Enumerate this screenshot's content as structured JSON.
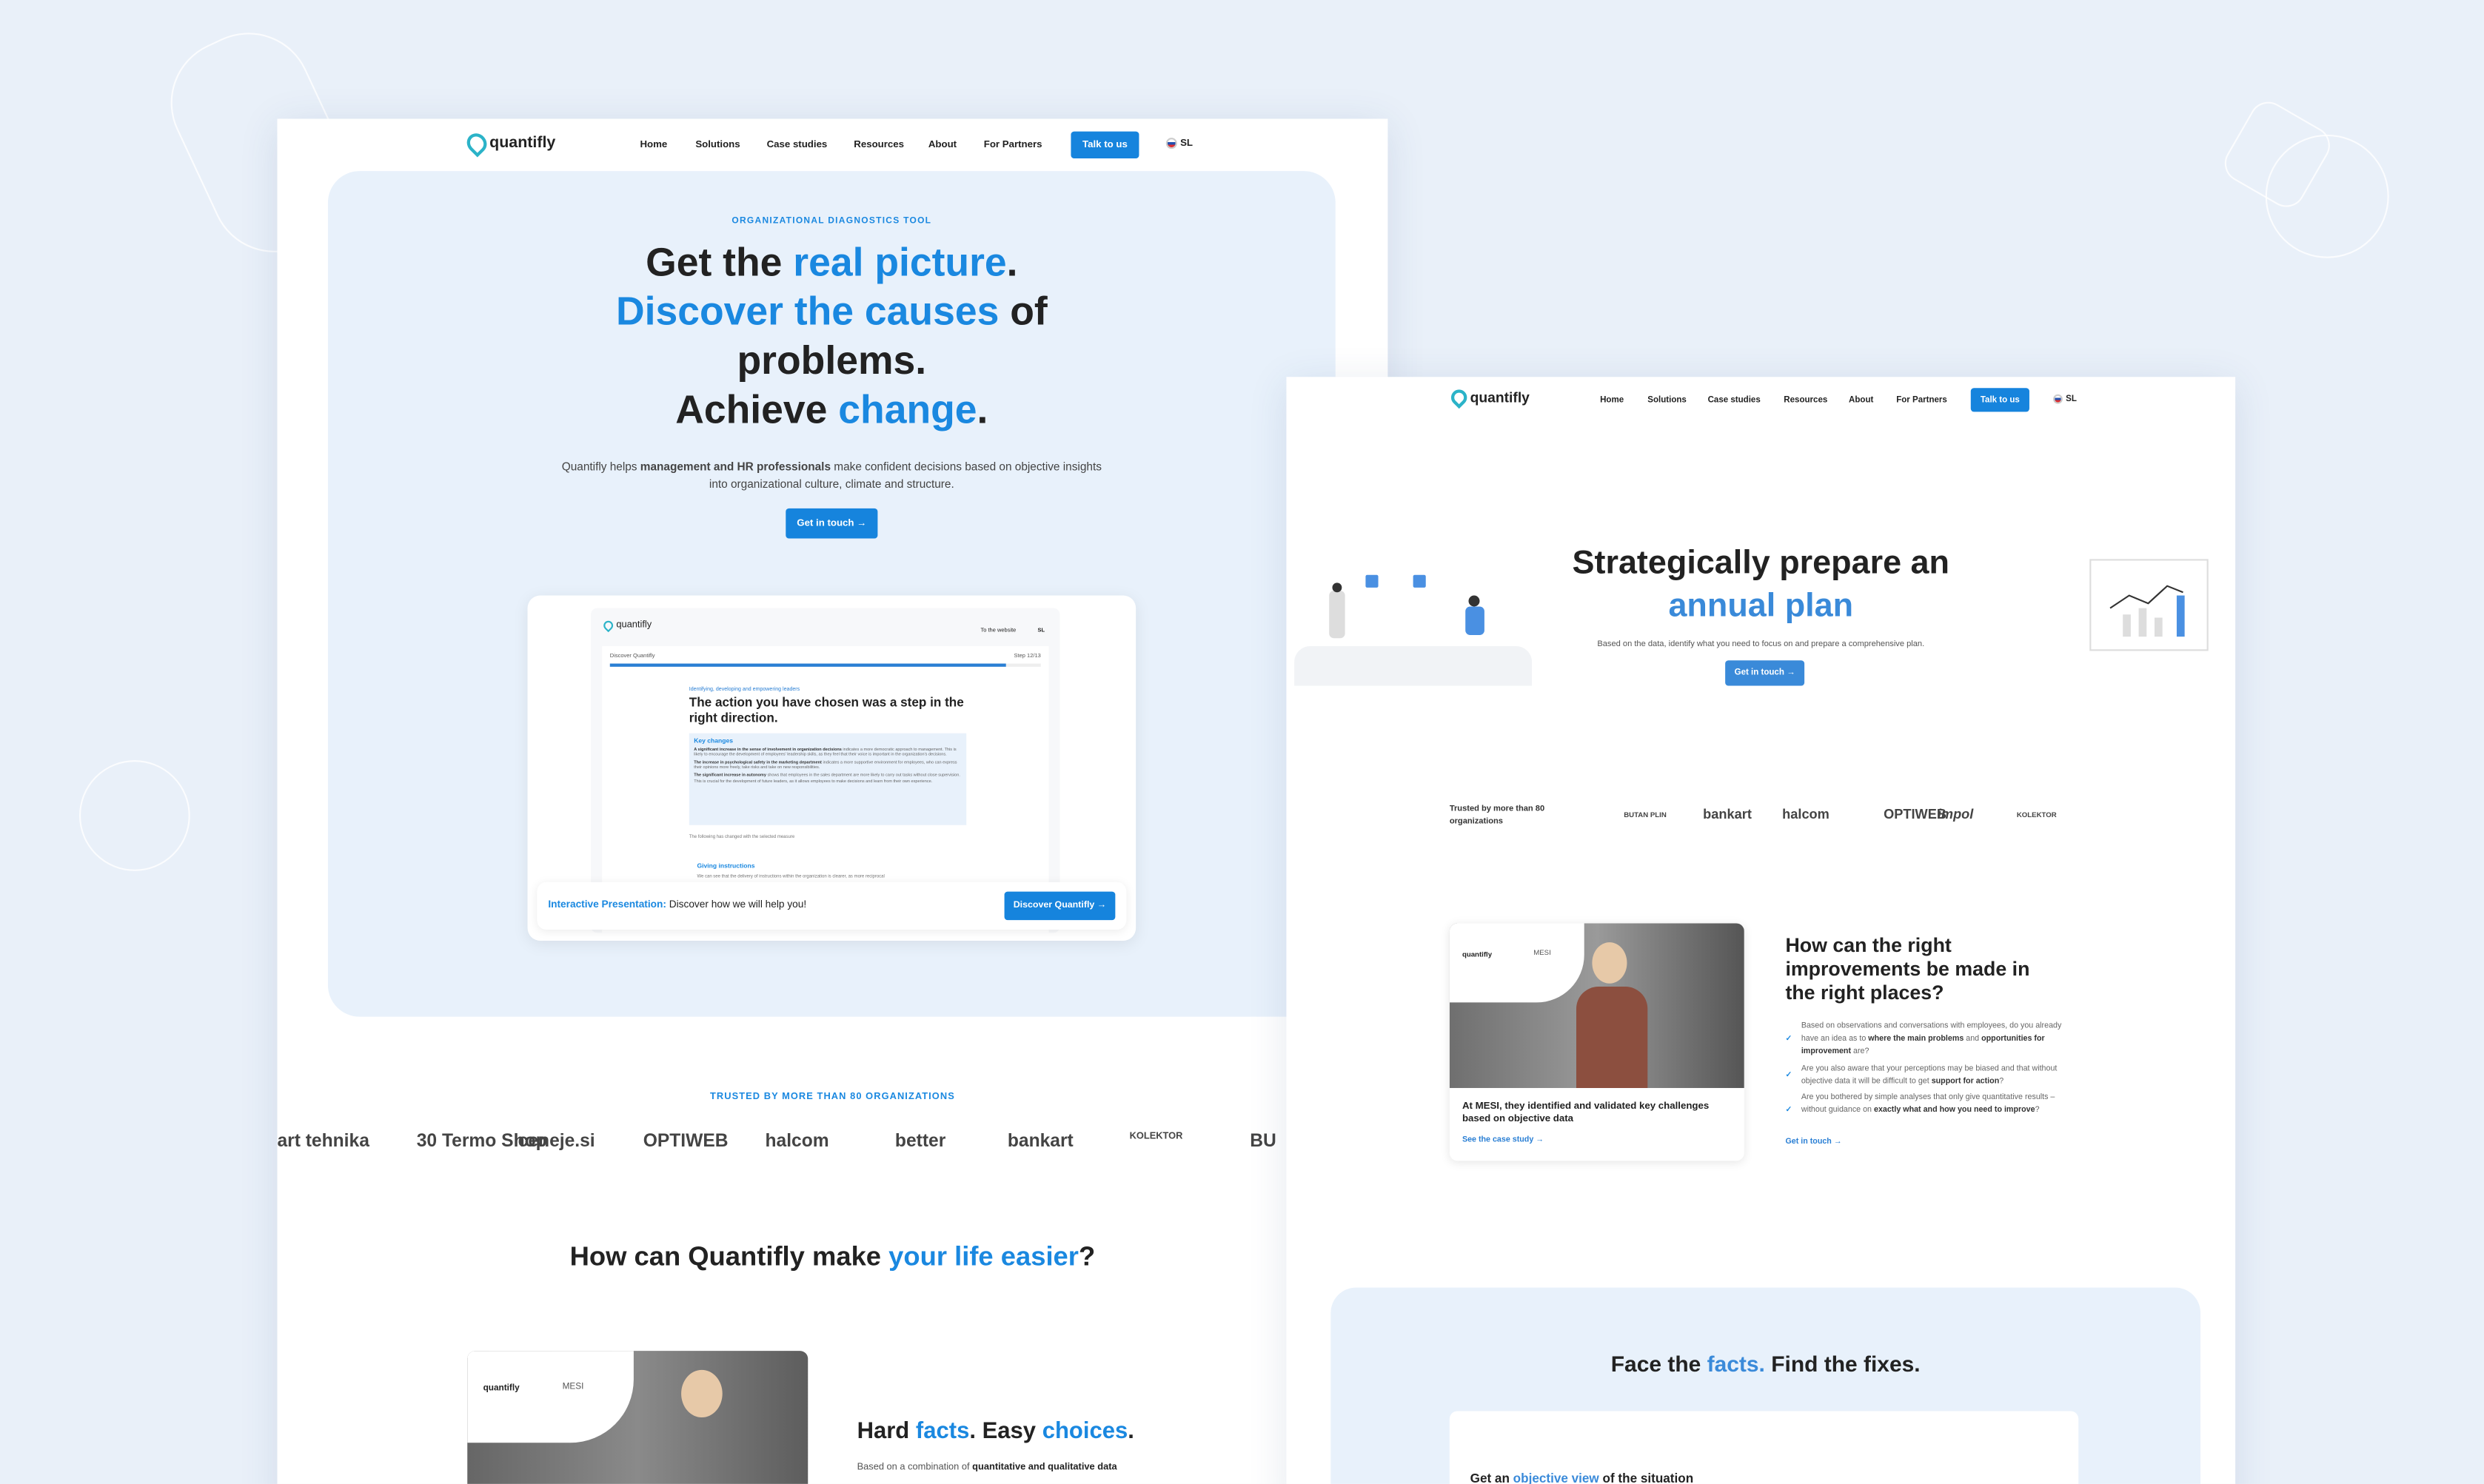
{
  "colors": {
    "accent": "#1a88e0",
    "background": "#e9f0f9",
    "hero_panel": "#e8f1fb"
  },
  "left": {
    "brand": "quantifly",
    "nav": [
      "Home",
      "Solutions",
      "Case studies",
      "Resources",
      "About",
      "For Partners"
    ],
    "cta": "Talk to us",
    "lang": "SL",
    "flag_icon": "slovenia-flag",
    "eyebrow": "ORGANIZATIONAL DIAGNOSTICS TOOL",
    "headline": {
      "l1a": "Get the ",
      "l1b": "real picture",
      "l1c": ".",
      "l2a": "Discover the causes",
      "l2b": " of",
      "l3": "problems.",
      "l4a": "Achieve ",
      "l4b": "change",
      "l4c": "."
    },
    "intro": {
      "a": "Quantifly helps ",
      "b": "management and HR professionals",
      "c": " make confident decisions based on objective insights into organizational culture, climate and structure."
    },
    "hero_button": "Get in touch →",
    "preview": {
      "brand": "quantifly",
      "to_website": "To the website",
      "lang": "SL",
      "progress_label": "Discover Quantifly",
      "step": "Step 12/13",
      "progress": 0.92,
      "eyebrow": "Identifying, developing and empowering leaders",
      "title": "The action you have chosen was a step in the right direction.",
      "key_title": "Key changes",
      "bullets": [
        {
          "b": "A significant increase in the sense of involvement in organization decisions",
          "t": " indicates a more democratic approach to management. This is likely to encourage the development of employees' leadership skills, as they feel that their voice is important in the organization's decisions."
        },
        {
          "b": "The increase in psychological safety in the marketing department",
          "t": " indicates a more supportive environment for employees, who can express their opinions more freely, take risks and take on new responsibilities."
        },
        {
          "b": "The significant increase in autonomy",
          "t": " shows that employees in the sales department are more likely to carry out tasks without close supervision. This is crucial for the development of future leaders, as it allows employees to make decisions and learn from their own experience."
        }
      ],
      "following": "The following has changed with the selected measure",
      "sub_title": "Giving instructions",
      "sub_text": "We can see that the delivery of instructions within the organization is clearer, as more reciprocal",
      "banner_label": "Interactive Presentation:",
      "banner_text": " Discover how we will help you!",
      "banner_button": "Discover Quantifly →"
    },
    "trusted": "TRUSTED BY MORE THAN 80 ORGANIZATIONS",
    "logos": [
      "art tehnika",
      "30 Termo Shop",
      "ceneje.si",
      "OPTIWEB",
      "halcom",
      "better",
      "bankart",
      "KOLEKTOR",
      "BU"
    ],
    "section_title": {
      "a": "How can Quantifly make ",
      "b": "your life easier",
      "c": "?"
    },
    "card_brand": "quantifly",
    "card_partner": "MESI",
    "hard": {
      "a": "Hard ",
      "b": "facts",
      "c": ". Easy ",
      "d": "choices",
      "e": "."
    },
    "hard_sub": {
      "a": "Based on a combination of ",
      "b": "quantitative and qualitative data"
    }
  },
  "right": {
    "brand": "quantifly",
    "nav": [
      "Home",
      "Solutions",
      "Case studies",
      "Resources",
      "About",
      "For Partners"
    ],
    "cta": "Talk to us",
    "lang": "SL",
    "headline1": "Strategically prepare an",
    "headline2": "annual plan",
    "sub": "Based on the data, identify what you need to focus on and prepare a comprehensive plan.",
    "button": "Get in touch →",
    "trusted": "Trusted by more than 80 organizations",
    "logos": [
      "BUTAN PLIN",
      "bankart",
      "halcom",
      "OPTIWEB",
      "impol",
      "KOLEKTOR"
    ],
    "card_brand": "quantifly",
    "card_partner": "MESI",
    "card_title": "At MESI, they identified and validated key challenges based on objective data",
    "card_link": "See the case study →",
    "question": "How can the right improvements be made in the right places?",
    "bullets": [
      {
        "a": "Based on observations and conversations with employees, do you already have an idea as to ",
        "b": "where the main problems",
        "c": " and ",
        "d": "opportunities for improvement",
        "e": " are?"
      },
      {
        "a": "Are you also aware that your perceptions may be biased and that without objective data it will be difficult to get ",
        "b": "support for action",
        "c": "?",
        "d": "",
        "e": ""
      },
      {
        "a": "Are you bothered by simple analyses that only give quantitative results – without guidance on ",
        "b": "exactly what and how you need to improve",
        "c": "?",
        "d": "",
        "e": ""
      }
    ],
    "get_in_touch": "Get in touch →",
    "facts": {
      "a": "Face the ",
      "b": "facts.",
      "c": " Find the fixes."
    },
    "objective": {
      "a": "Get an ",
      "b": "objective view",
      "c": " of the situation"
    }
  }
}
